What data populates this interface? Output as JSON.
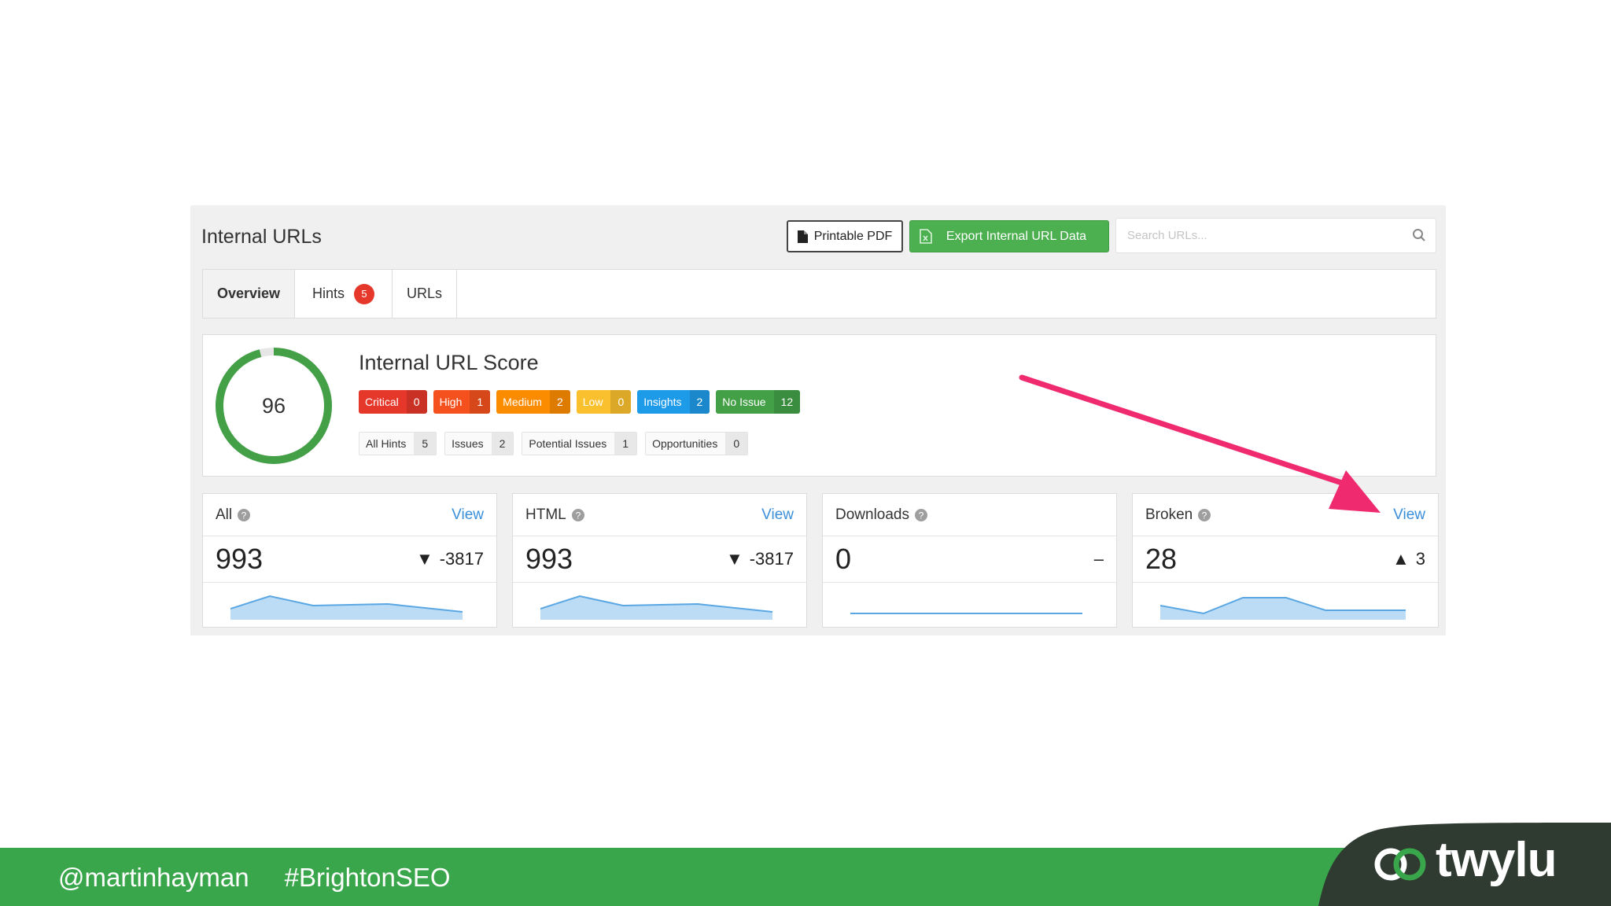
{
  "panel": {
    "title": "Internal URLs",
    "printable_pdf": "Printable PDF",
    "export_label": "Export Internal URL Data",
    "search_placeholder": "Search URLs..."
  },
  "tabs": [
    {
      "label": "Overview",
      "active": true
    },
    {
      "label": "Hints",
      "badge": "5"
    },
    {
      "label": "URLs"
    }
  ],
  "score": {
    "title": "Internal URL Score",
    "value": "96",
    "fraction": 0.96,
    "severities": [
      {
        "label": "Critical",
        "count": "0",
        "color": "#e5382a"
      },
      {
        "label": "High",
        "count": "1",
        "color": "#f4511e"
      },
      {
        "label": "Medium",
        "count": "2",
        "color": "#fb8c00"
      },
      {
        "label": "Low",
        "count": "0",
        "color": "#fbc02d"
      },
      {
        "label": "Insights",
        "count": "2",
        "color": "#1e9be8"
      },
      {
        "label": "No Issue",
        "count": "12",
        "color": "#43a047"
      }
    ],
    "hints": [
      {
        "label": "All Hints",
        "count": "5"
      },
      {
        "label": "Issues",
        "count": "2"
      },
      {
        "label": "Potential Issues",
        "count": "1"
      },
      {
        "label": "Opportunities",
        "count": "0"
      }
    ]
  },
  "stats": [
    {
      "label": "All",
      "view": "View",
      "value": "993",
      "trend": "▼",
      "change": "-3817"
    },
    {
      "label": "HTML",
      "view": "View",
      "value": "993",
      "trend": "▼",
      "change": "-3817"
    },
    {
      "label": "Downloads",
      "view": "",
      "value": "0",
      "trend": "",
      "change": "–"
    },
    {
      "label": "Broken",
      "view": "View",
      "value": "28",
      "trend": "▲",
      "change": "3"
    }
  ],
  "footer": {
    "handle": "@martinhayman",
    "hashtag": "#BrightonSEO",
    "brand": "twylu"
  },
  "colors": {
    "accent_green": "#4caf50",
    "footer_green": "#3aa64b",
    "link_blue": "#3a8fd9",
    "arrow_pink": "#ef2a6f"
  }
}
